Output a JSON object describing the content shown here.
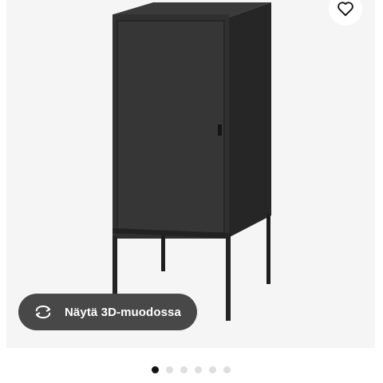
{
  "product": {
    "image_label": "",
    "favorite_icon": "heart-icon"
  },
  "view3d": {
    "label": "Näytä 3D-muodossa",
    "icon": "rotate-3d-icon"
  },
  "pager": {
    "count": 6,
    "active_index": 0
  },
  "colors": {
    "cabinet": "#2b2b2b",
    "button_bg": "#484848",
    "dot_active": "#111111",
    "dot_inactive": "#dfdfdf"
  }
}
